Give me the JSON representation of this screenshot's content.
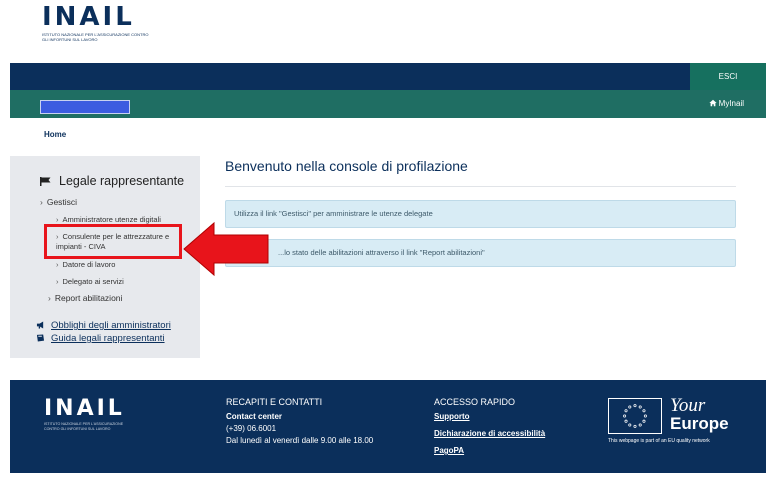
{
  "brand": {
    "name": "INAIL",
    "subtitle": "ISTITUTO NAZIONALE PER L'ASSICURAZIONE CONTRO GLI INFORTUNI SUL LAVORO"
  },
  "topbar": {
    "logout": "ESCI",
    "myinail": "MyInail"
  },
  "breadcrumb": "Home",
  "sidebar": {
    "title": "Legale rappresentante",
    "manage": "Gestisci",
    "sub_items": [
      "Amministratore utenze digitali",
      "Consulente per le attrezzature e impianti - CIVA",
      "Datore di lavoro",
      "Delegato ai servizi"
    ],
    "report": "Report abilitazioni",
    "links": [
      "Obblighi degli amministratori",
      "Guida legali rappresentanti"
    ]
  },
  "main": {
    "title": "Benvenuto nella console di profilazione",
    "info": [
      "Utilizza il link \"Gestisci\" per amministrare le utenze delegate",
      "...lo stato delle abilitazioni attraverso il link \"Report abilitazioni\""
    ]
  },
  "footer": {
    "contacts_title": "RECAPITI E CONTATTI",
    "contact_center": "Contact center",
    "phone": "(+39) 06.6001",
    "hours": "Dal lunedì al venerdì dalle 9.00 alle 18.00",
    "quick_title": "ACCESSO RAPIDO",
    "quick_links": [
      "Supporto",
      "Dichiarazione di accessibilità",
      "PagoPA"
    ],
    "eu_line1": "Your",
    "eu_line2": "Europe",
    "eu_caption": "This webpage is part of an EU quality network"
  },
  "colors": {
    "navy": "#0b2f5b",
    "teal": "#1f6e63",
    "highlight": "#e8141b"
  }
}
